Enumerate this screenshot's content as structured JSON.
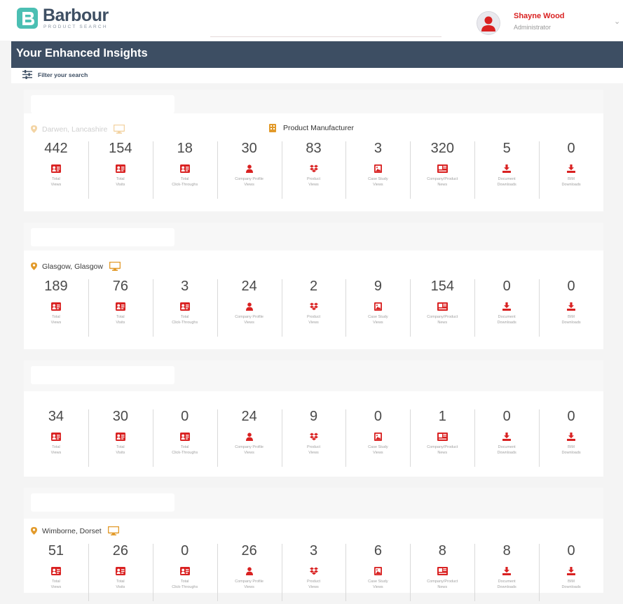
{
  "header": {
    "logo_text": "Barbour",
    "logo_sub": "PRODUCT SEARCH",
    "user_name": "Shayne Wood",
    "user_role": "Administrator",
    "chevron": "⌄"
  },
  "banner": {
    "title": "Your Enhanced Insights"
  },
  "filter": {
    "label": "Filter your search"
  },
  "colors": {
    "accent": "#d92121",
    "navy": "#3d4e63",
    "teal": "#4bbfb3"
  },
  "icons": {
    "views": "id-card-icon",
    "visits": "id-card-icon",
    "clicks": "id-card-icon",
    "company": "person-icon",
    "product": "dropbox-icon",
    "case": "image-icon",
    "news": "newspaper-icon",
    "docs": "download-icon",
    "bim": "download-icon"
  },
  "metric_labels": [
    [
      "Total",
      "Views"
    ],
    [
      "Total",
      "Visits"
    ],
    [
      "Total",
      "Click-Throughs"
    ],
    [
      "Company Profile",
      "Views"
    ],
    [
      "Product",
      "Views"
    ],
    [
      "Case Study",
      "Views"
    ],
    [
      "Company/Product",
      "News"
    ],
    [
      "Document",
      "Downloads"
    ],
    [
      "BIM",
      "Downloads"
    ]
  ],
  "groups": [
    {
      "location": "Darwen, Lancashire",
      "product_type": "Product Manufacturer",
      "values": [
        "442",
        "154",
        "18",
        "30",
        "83",
        "3",
        "320",
        "5",
        "0"
      ]
    },
    {
      "location": "Glasgow, Glasgow",
      "product_type": "",
      "values": [
        "189",
        "76",
        "3",
        "24",
        "2",
        "9",
        "154",
        "0",
        "0"
      ]
    },
    {
      "location": "",
      "product_type": "",
      "values": [
        "34",
        "30",
        "0",
        "24",
        "9",
        "0",
        "1",
        "0",
        "0"
      ]
    },
    {
      "location": "Wimborne, Dorset",
      "product_type": "",
      "values": [
        "51",
        "26",
        "0",
        "26",
        "3",
        "6",
        "8",
        "8",
        "0"
      ]
    }
  ]
}
